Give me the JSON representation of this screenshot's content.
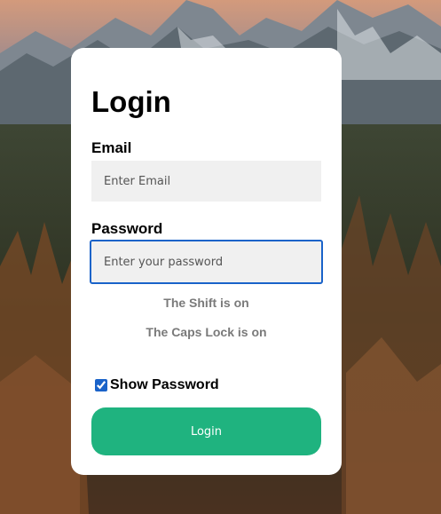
{
  "login": {
    "title": "Login",
    "email_label": "Email",
    "email_placeholder": "Enter Email",
    "password_label": "Password",
    "password_placeholder": "Enter your password",
    "shift_message": "The Shift is on",
    "caps_message": "The Caps Lock is on",
    "show_password_label": "Show Password",
    "show_password_checked": true,
    "button_label": "Login"
  },
  "colors": {
    "button": "#1fb37f",
    "focus_border": "#1a63c9",
    "field_background": "#f0f0f0",
    "hint_text": "#7a7a7a",
    "card": "#ffffff"
  },
  "background": {
    "description_icon": "mountain-forest-landscape"
  }
}
